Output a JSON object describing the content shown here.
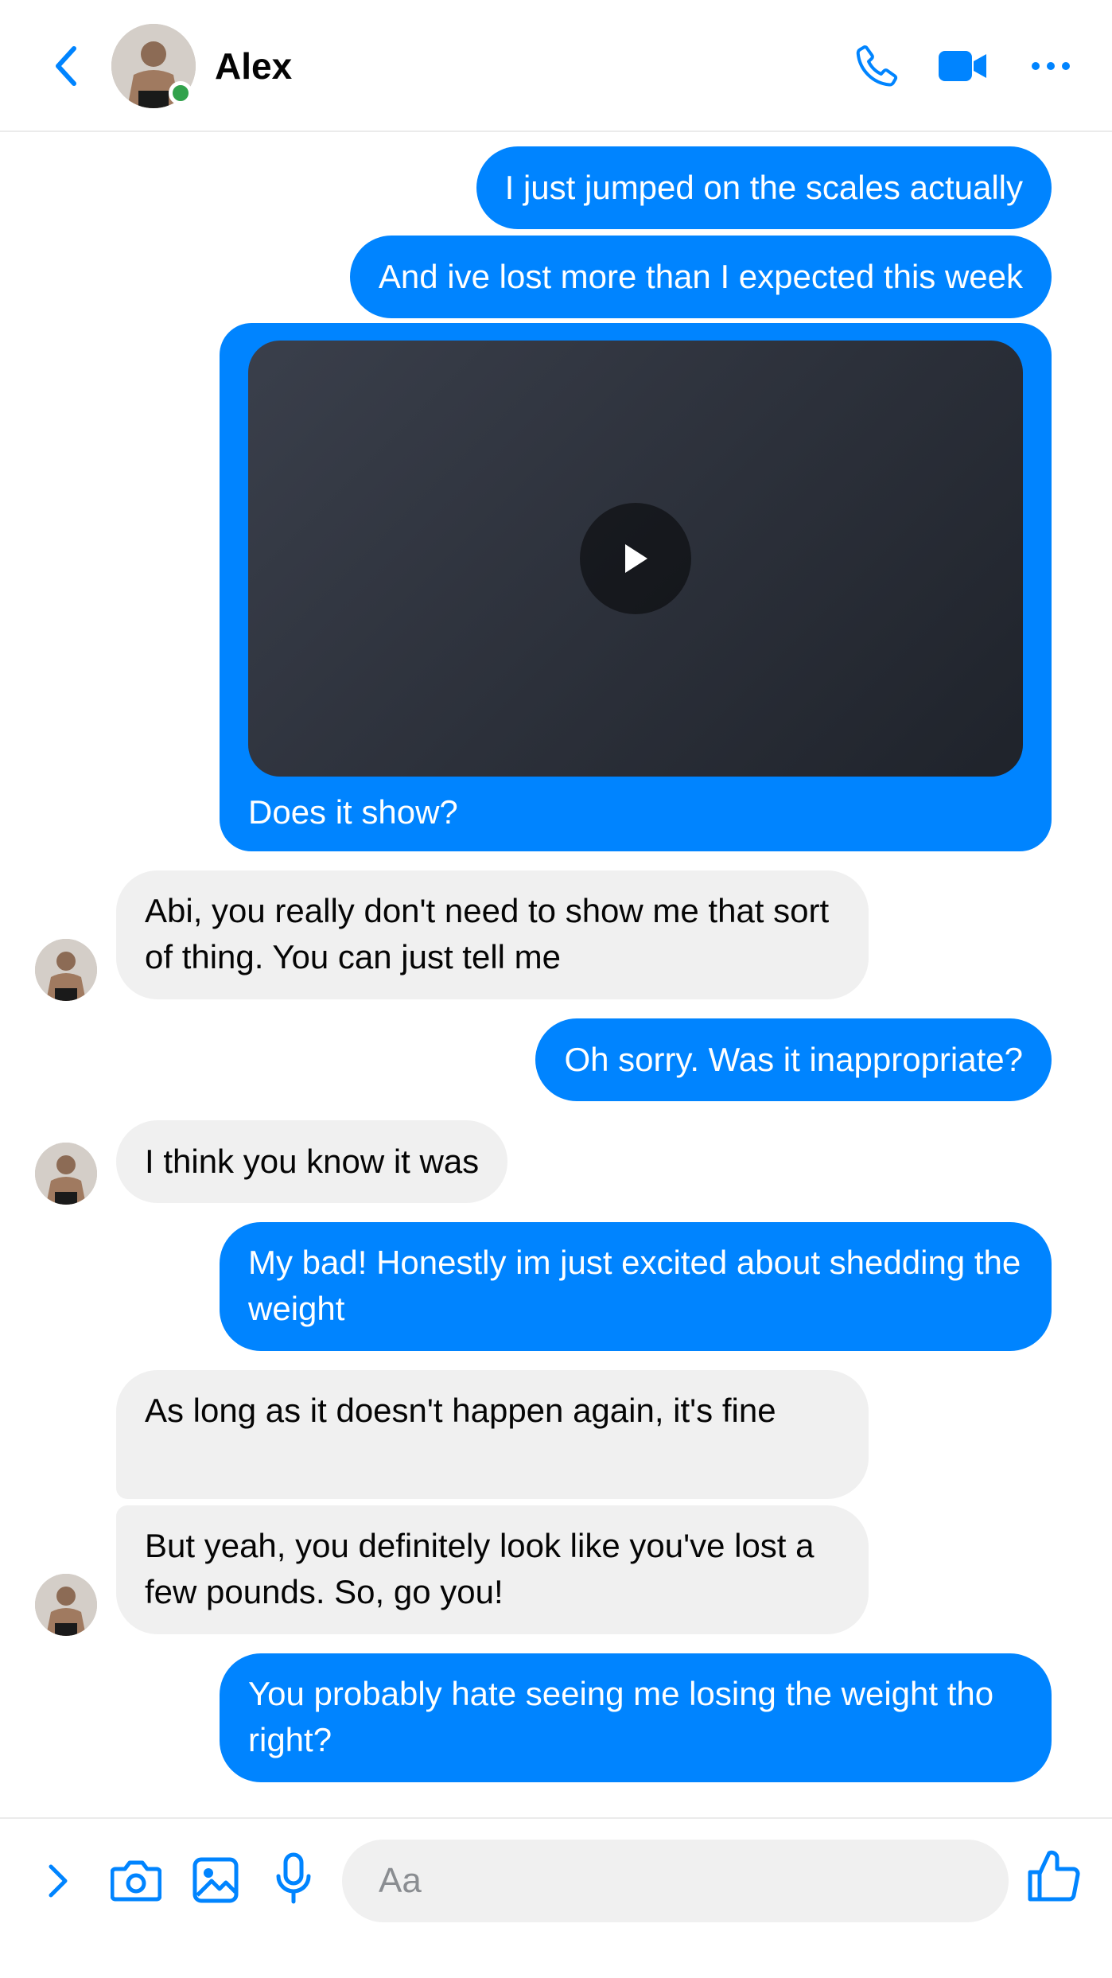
{
  "header": {
    "contact_name": "Alex",
    "icons": [
      "back-chevron-icon",
      "phone-icon",
      "video-call-icon",
      "more-icon"
    ],
    "status": "online"
  },
  "messages": [
    {
      "from": "me",
      "text": "I just jumped on the scales actually"
    },
    {
      "from": "me",
      "text": "And ive lost more than I expected this week"
    },
    {
      "from": "me",
      "type": "video",
      "caption": "Does it show?"
    },
    {
      "from": "them",
      "text": "Abi, you really don't need to show me that sort of thing. You can just tell me"
    },
    {
      "from": "me",
      "text": "Oh sorry. Was it inappropriate?"
    },
    {
      "from": "them",
      "text": "I think you know it was"
    },
    {
      "from": "me",
      "text": "My bad! Honestly im just excited about shedding the weight"
    },
    {
      "from": "them",
      "text": "As long as it doesn't happen again, it's fine"
    },
    {
      "from": "them",
      "text": "But yeah, you definitely look like you've lost a few pounds. So, go you!"
    },
    {
      "from": "me",
      "text": "You probably hate seeing me losing the weight tho right?"
    }
  ],
  "composer": {
    "placeholder": "Aa",
    "icons": [
      "expand-chevron-icon",
      "camera-icon",
      "image-icon",
      "microphone-icon",
      "thumbs-up-icon"
    ]
  },
  "colors": {
    "accent": "#0084ff",
    "outgoing_bubble": "#0084ff",
    "incoming_bubble": "#f0f0f0",
    "online": "#31a24c"
  }
}
